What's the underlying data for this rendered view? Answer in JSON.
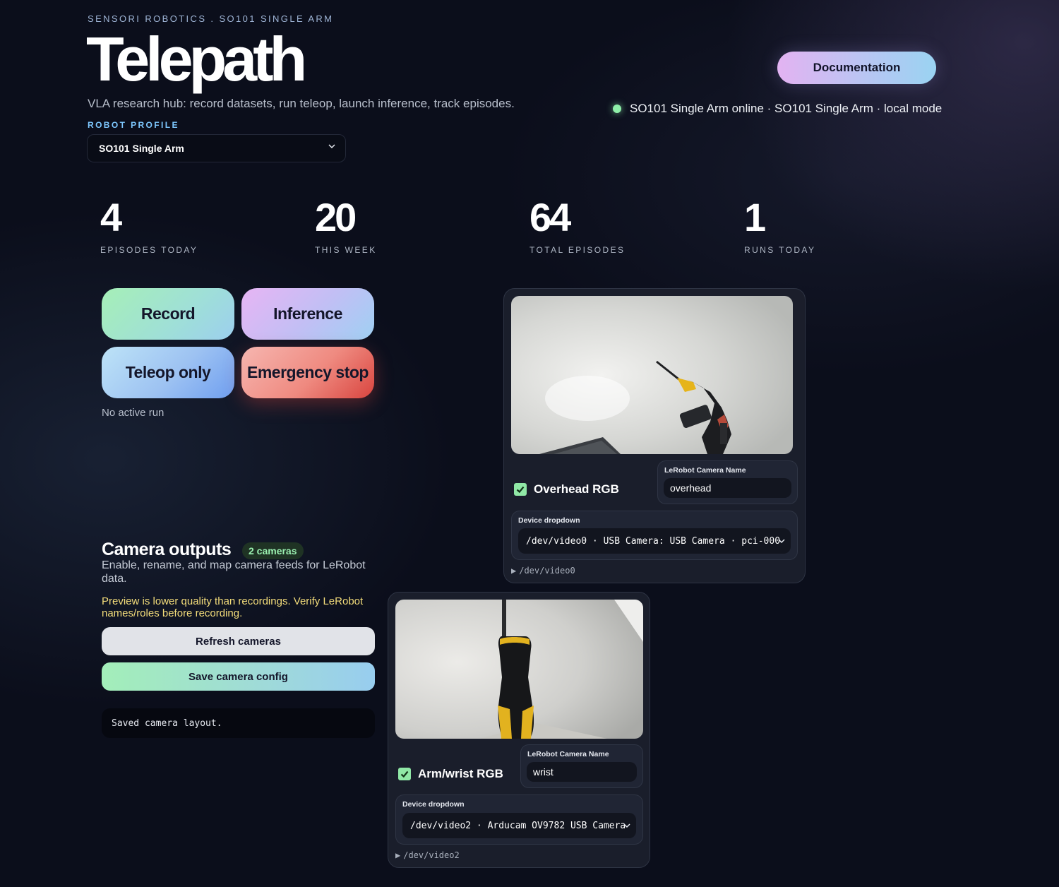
{
  "header": {
    "eyebrow": "SENSORI ROBOTICS . SO101 SINGLE ARM",
    "brand": "Telepath",
    "subtitle": "VLA research hub: record datasets, run teleop, launch inference, track episodes.",
    "profile_label": "ROBOT PROFILE",
    "profile_value": "SO101 Single Arm",
    "doc_button": "Documentation",
    "status_text": "SO101 Single Arm online · SO101 Single Arm · local mode",
    "status_color": "#8ff0a9"
  },
  "stats": [
    {
      "value": "4",
      "label": "EPISODES TODAY"
    },
    {
      "value": "20",
      "label": "THIS WEEK"
    },
    {
      "value": "64",
      "label": "TOTAL EPISODES"
    },
    {
      "value": "1",
      "label": "RUNS TODAY"
    }
  ],
  "actions": {
    "record": "Record",
    "inference": "Inference",
    "teleop": "Teleop only",
    "estop": "Emergency stop",
    "run_status": "No active run"
  },
  "cameras": {
    "title": "Camera outputs",
    "badge": "2 cameras",
    "description": "Enable, rename, and map camera feeds for LeRobot data.",
    "warning": "Preview is lower quality than recordings. Verify LeRobot names/roles before recording.",
    "refresh_button": "Refresh cameras",
    "save_button": "Save camera config",
    "log": "Saved camera layout.",
    "name_label": "LeRobot Camera Name",
    "device_label": "Device dropdown",
    "feeds": [
      {
        "label": "Overhead RGB",
        "enabled": true,
        "name": "overhead",
        "device": "/dev/video0 · USB Camera: USB Camera · pci-000",
        "path": "/dev/video0"
      },
      {
        "label": "Arm/wrist RGB",
        "enabled": true,
        "name": "wrist",
        "device": "/dev/video2 · Arducam OV9782 USB Camera",
        "path": "/dev/video2"
      }
    ]
  }
}
